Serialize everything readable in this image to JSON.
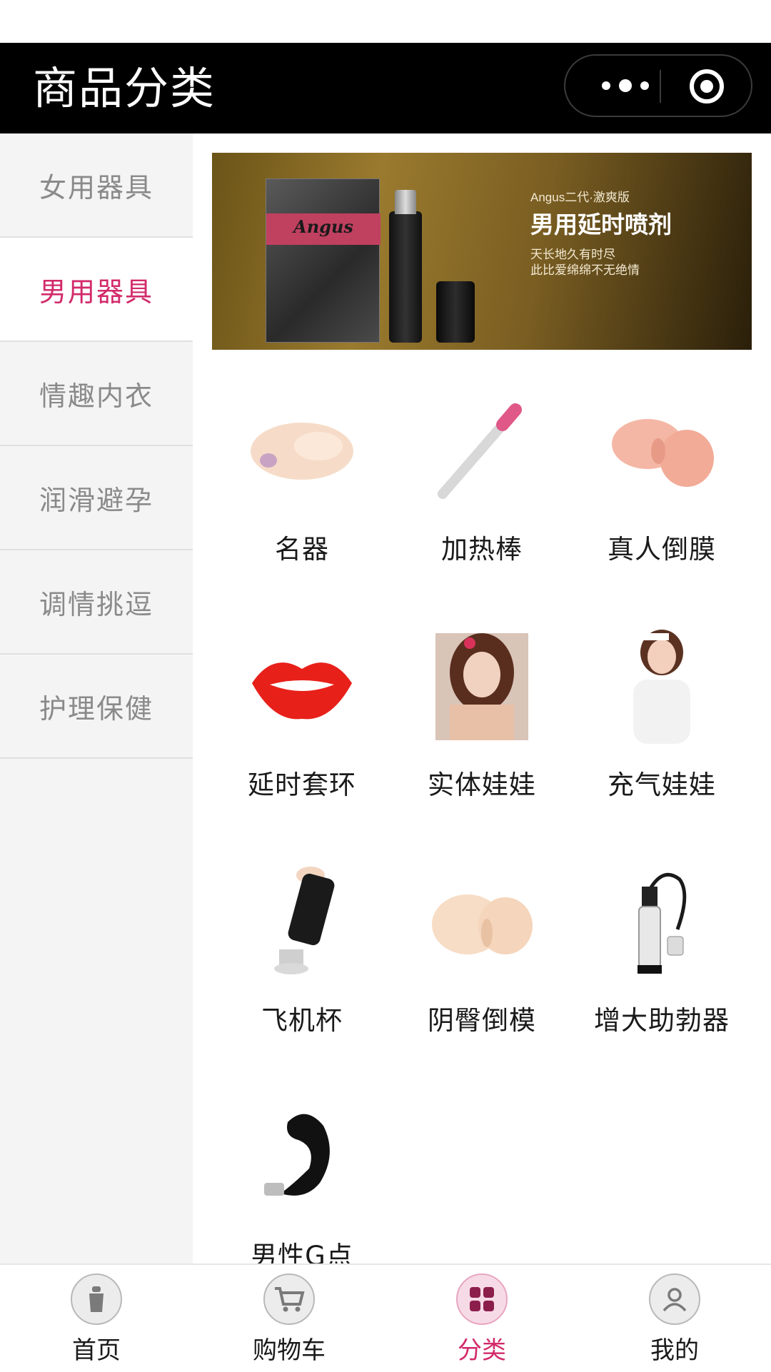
{
  "header": {
    "title": "商品分类"
  },
  "sidebar": {
    "items": [
      {
        "label": "女用器具"
      },
      {
        "label": "男用器具"
      },
      {
        "label": "情趣内衣"
      },
      {
        "label": "润滑避孕"
      },
      {
        "label": "调情挑逗"
      },
      {
        "label": "护理保健"
      }
    ],
    "active_index": 1
  },
  "banner": {
    "box_brand": "Angus",
    "subtitle": "Angus二代·激爽版",
    "headline": "男用延时喷剂",
    "line1": "天长地久有时尽",
    "line2": "此比爱绵绵不无绝情"
  },
  "products": [
    {
      "label": "名器",
      "icon": "sleeve-icon"
    },
    {
      "label": "加热棒",
      "icon": "heating-rod-icon"
    },
    {
      "label": "真人倒膜",
      "icon": "mold-icon"
    },
    {
      "label": "延时套环",
      "icon": "lips-ring-icon"
    },
    {
      "label": "实体娃娃",
      "icon": "doll-icon"
    },
    {
      "label": "充气娃娃",
      "icon": "inflatable-doll-icon"
    },
    {
      "label": "飞机杯",
      "icon": "cup-icon"
    },
    {
      "label": "阴臀倒模",
      "icon": "hip-mold-icon"
    },
    {
      "label": "增大助勃器",
      "icon": "pump-icon"
    },
    {
      "label": "男性G点",
      "icon": "prostate-icon"
    }
  ],
  "tabbar": {
    "items": [
      {
        "label": "首页",
        "icon": "home-icon"
      },
      {
        "label": "购物车",
        "icon": "cart-icon"
      },
      {
        "label": "分类",
        "icon": "category-icon"
      },
      {
        "label": "我的",
        "icon": "user-icon"
      }
    ],
    "active_index": 2
  },
  "colors": {
    "accent": "#d22a6a",
    "topbar": "#000000",
    "sidebar_bg": "#f4f4f4"
  }
}
